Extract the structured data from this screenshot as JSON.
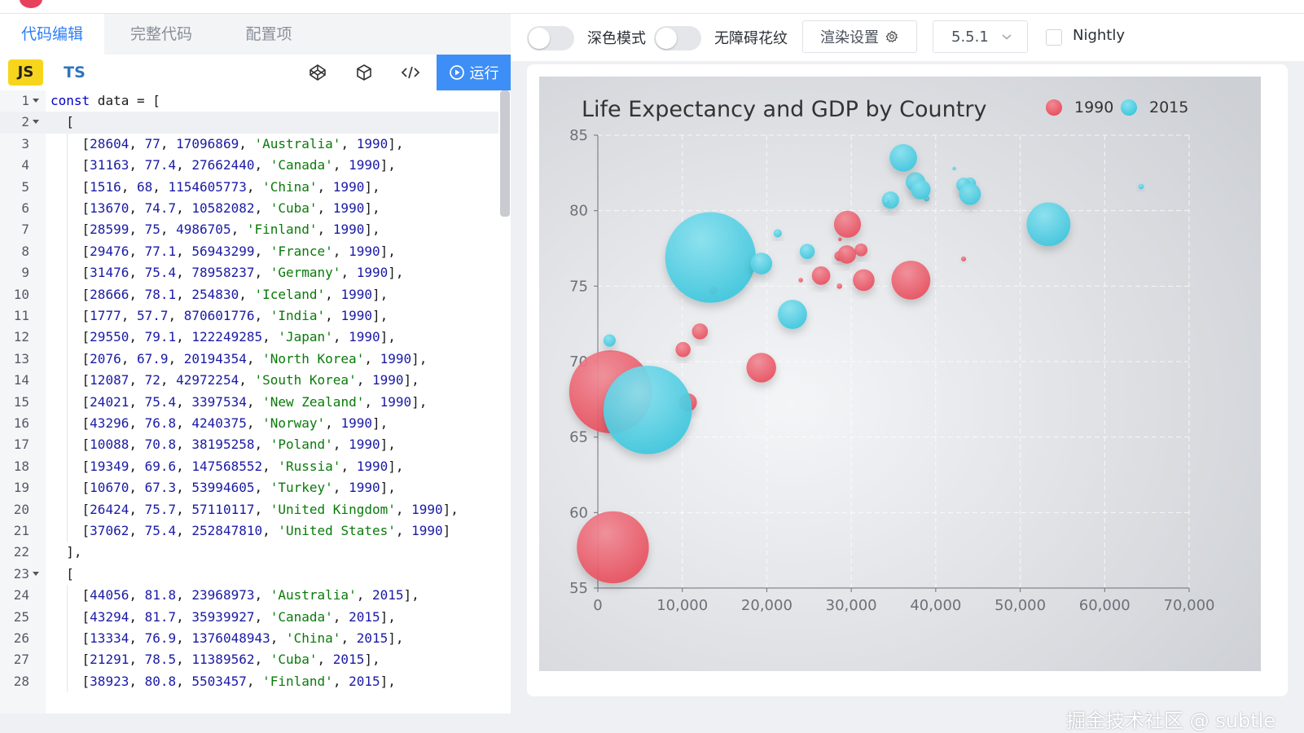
{
  "left_tabs": [
    {
      "label": "代码编辑",
      "active": true
    },
    {
      "label": "完整代码",
      "active": false
    },
    {
      "label": "配置项",
      "active": false
    }
  ],
  "toolbar": {
    "js_label": "JS",
    "ts_label": "TS",
    "run_label": "运行",
    "icons": [
      "codepen-icon",
      "box-icon",
      "code-icon"
    ]
  },
  "code_lines": [
    {
      "n": "1",
      "fold": true,
      "text": "const data = ["
    },
    {
      "n": "2",
      "fold": true,
      "text": "  [",
      "current": true
    },
    {
      "n": "3",
      "text": "    [28604, 77, 17096869, 'Australia', 1990],"
    },
    {
      "n": "4",
      "text": "    [31163, 77.4, 27662440, 'Canada', 1990],"
    },
    {
      "n": "5",
      "text": "    [1516, 68, 1154605773, 'China', 1990],"
    },
    {
      "n": "6",
      "text": "    [13670, 74.7, 10582082, 'Cuba', 1990],"
    },
    {
      "n": "7",
      "text": "    [28599, 75, 4986705, 'Finland', 1990],"
    },
    {
      "n": "8",
      "text": "    [29476, 77.1, 56943299, 'France', 1990],"
    },
    {
      "n": "9",
      "text": "    [31476, 75.4, 78958237, 'Germany', 1990],"
    },
    {
      "n": "10",
      "text": "    [28666, 78.1, 254830, 'Iceland', 1990],"
    },
    {
      "n": "11",
      "text": "    [1777, 57.7, 870601776, 'India', 1990],"
    },
    {
      "n": "12",
      "text": "    [29550, 79.1, 122249285, 'Japan', 1990],"
    },
    {
      "n": "13",
      "text": "    [2076, 67.9, 20194354, 'North Korea', 1990],"
    },
    {
      "n": "14",
      "text": "    [12087, 72, 42972254, 'South Korea', 1990],"
    },
    {
      "n": "15",
      "text": "    [24021, 75.4, 3397534, 'New Zealand', 1990],"
    },
    {
      "n": "16",
      "text": "    [43296, 76.8, 4240375, 'Norway', 1990],"
    },
    {
      "n": "17",
      "text": "    [10088, 70.8, 38195258, 'Poland', 1990],"
    },
    {
      "n": "18",
      "text": "    [19349, 69.6, 147568552, 'Russia', 1990],"
    },
    {
      "n": "19",
      "text": "    [10670, 67.3, 53994605, 'Turkey', 1990],"
    },
    {
      "n": "20",
      "text": "    [26424, 75.7, 57110117, 'United Kingdom', 1990],"
    },
    {
      "n": "21",
      "text": "    [37062, 75.4, 252847810, 'United States', 1990]"
    },
    {
      "n": "22",
      "text": "  ],"
    },
    {
      "n": "23",
      "fold": true,
      "text": "  ["
    },
    {
      "n": "24",
      "text": "    [44056, 81.8, 23968973, 'Australia', 2015],"
    },
    {
      "n": "25",
      "text": "    [43294, 81.7, 35939927, 'Canada', 2015],"
    },
    {
      "n": "26",
      "text": "    [13334, 76.9, 1376048943, 'China', 2015],"
    },
    {
      "n": "27",
      "text": "    [21291, 78.5, 11389562, 'Cuba', 2015],"
    },
    {
      "n": "28",
      "text": "    [38923, 80.8, 5503457, 'Finland', 2015],"
    }
  ],
  "render_toolbar": {
    "dark_mode_label": "深色模式",
    "decal_label": "无障碍花纹",
    "render_settings_label": "渲染设置",
    "version_value": "5.5.1",
    "nightly_label": "Nightly"
  },
  "watermark": "掘金技术社区 @ subtle",
  "colors": {
    "accent": "#3e8ef7",
    "series_1990": "#e8505f",
    "series_2015": "#4fd0e6"
  },
  "chart_data": {
    "type": "scatter",
    "title": "Life Expectancy and GDP by Country",
    "xlabel": "",
    "ylabel": "",
    "xlim": [
      0,
      70000
    ],
    "ylim": [
      55,
      85
    ],
    "x_ticks": [
      "0",
      "10,000",
      "20,000",
      "30,000",
      "40,000",
      "50,000",
      "60,000",
      "70,000"
    ],
    "y_ticks": [
      "55",
      "60",
      "65",
      "70",
      "75",
      "80",
      "85"
    ],
    "legend_position": "top-right",
    "grid": true,
    "series": [
      {
        "name": "1990",
        "color": "#e8505f",
        "points": [
          [
            28604,
            77,
            17096869
          ],
          [
            31163,
            77.4,
            27662440
          ],
          [
            1516,
            68,
            1154605773
          ],
          [
            13670,
            74.7,
            10582082
          ],
          [
            28599,
            75,
            4986705
          ],
          [
            29476,
            77.1,
            56943299
          ],
          [
            31476,
            75.4,
            78958237
          ],
          [
            28666,
            78.1,
            254830
          ],
          [
            1777,
            57.7,
            870601776
          ],
          [
            29550,
            79.1,
            122249285
          ],
          [
            2076,
            67.9,
            20194354
          ],
          [
            12087,
            72,
            42972254
          ],
          [
            24021,
            75.4,
            3397534
          ],
          [
            43296,
            76.8,
            4240375
          ],
          [
            10088,
            70.8,
            38195258
          ],
          [
            19349,
            69.6,
            147568552
          ],
          [
            10670,
            67.3,
            53994605
          ],
          [
            26424,
            75.7,
            57110117
          ],
          [
            37062,
            75.4,
            252847810
          ]
        ]
      },
      {
        "name": "2015",
        "color": "#4fd0e6",
        "points": [
          [
            44056,
            81.8,
            23968973
          ],
          [
            43294,
            81.7,
            35939927
          ],
          [
            13334,
            76.9,
            1376048943
          ],
          [
            21291,
            78.5,
            11389562
          ],
          [
            38923,
            80.8,
            5503457
          ],
          [
            37599,
            81.9,
            64395345
          ],
          [
            44053,
            81.1,
            80688545
          ],
          [
            42182,
            82.8,
            329425
          ],
          [
            5903,
            66.8,
            1311050527
          ],
          [
            36162,
            83.5,
            126573481
          ],
          [
            1390,
            71.4,
            25155317
          ],
          [
            34644,
            80.7,
            50293439
          ],
          [
            34186,
            80.6,
            4528526
          ],
          [
            64304,
            81.6,
            5210967
          ],
          [
            24787,
            77.3,
            38611794
          ],
          [
            23038,
            73.13,
            143456918
          ],
          [
            19360,
            76.5,
            78665830
          ],
          [
            38225,
            81.4,
            64715810
          ],
          [
            53354,
            79.1,
            321773631
          ]
        ]
      }
    ]
  }
}
